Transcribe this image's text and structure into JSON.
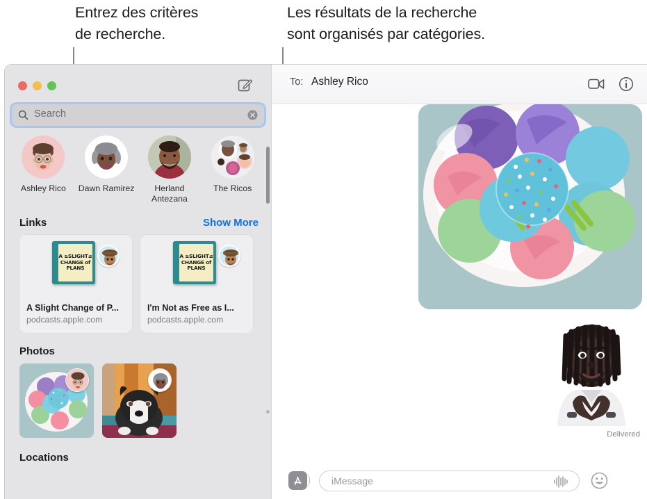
{
  "callouts": {
    "left": "Entrez des critères\nde recherche.",
    "right": "Les résultats de la recherche\nsont organisés par catégories."
  },
  "colors": {
    "accent_blue": "#0a72ef",
    "focus_ring": "#a8c7f5",
    "sidebar_bg": "#e4e3e6",
    "traffic_red": "#ec6a5f",
    "traffic_yellow": "#f4bd4f",
    "traffic_green": "#61c454",
    "leader_line": "#86868b"
  },
  "window": {
    "traffic_lights": [
      "close",
      "minimize",
      "zoom"
    ],
    "compose_icon": "compose-icon"
  },
  "search": {
    "placeholder": "Search",
    "value": "",
    "icon": "search-icon",
    "clear_icon": "clear-icon"
  },
  "contacts": [
    {
      "name": "Ashley Rico",
      "avatar": "memoji-ashley"
    },
    {
      "name": "Dawn Ramirez",
      "avatar": "memoji-dawn"
    },
    {
      "name": "Herland Antezana",
      "avatar": "photo-herland"
    },
    {
      "name": "The Ricos",
      "avatar": "group-ricos"
    }
  ],
  "links": {
    "title": "Links",
    "show_more": "Show More",
    "items": [
      {
        "title": "A Slight Change of P...",
        "host": "podcasts.apple.com",
        "artwork_lines": [
          "A ≥SLIGHT≤",
          "CHANGE of",
          "PLANS"
        ],
        "sender_avatar": "memoji-hat"
      },
      {
        "title": "I'm Not as Free as I...",
        "host": "podcasts.apple.com",
        "artwork_lines": [
          "A ≥SLIGHT≤",
          "CHANGE of",
          "PLANS"
        ],
        "sender_avatar": "memoji-hat"
      }
    ]
  },
  "photos": {
    "title": "Photos",
    "items": [
      {
        "description": "plate-of-macarons",
        "sender_avatar": "memoji-ashley"
      },
      {
        "description": "boston-terrier-dog",
        "sender_avatar": "memoji-dawn"
      }
    ]
  },
  "locations": {
    "title": "Locations"
  },
  "conversation": {
    "to_label": "To:",
    "to_name": "Ashley Rico",
    "facetime_icon": "video-camera-icon",
    "info_icon": "info-icon",
    "messages": [
      {
        "type": "photo",
        "description": "plate-of-macarons"
      },
      {
        "type": "sticker",
        "description": "memoji-heart-hands"
      }
    ],
    "status": "Delivered",
    "composer": {
      "apps_icon": "app-store-icon",
      "placeholder": "iMessage",
      "value": "",
      "audio_icon": "audio-waveform-icon",
      "emoji_icon": "smiley-icon"
    }
  }
}
